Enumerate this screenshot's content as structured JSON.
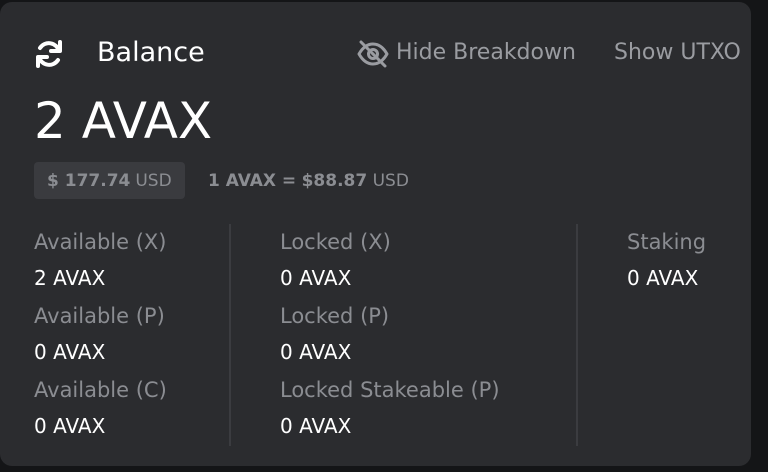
{
  "header": {
    "refresh_icon": "refresh-icon",
    "title": "Balance",
    "hide_icon": "eye-off-icon",
    "hide_breakdown_label": "Hide Breakdown",
    "show_utxo_label": "Show UTXO"
  },
  "balance": {
    "total": "2 AVAX",
    "usd_amount": "$ 177.74",
    "usd_currency": "USD",
    "rate_prefix": "1 AVAX =",
    "rate_value": "$88.87",
    "rate_currency": "USD"
  },
  "breakdown": {
    "available_x": {
      "label": "Available (X)",
      "value": "2 AVAX"
    },
    "available_p": {
      "label": "Available (P)",
      "value": "0 AVAX"
    },
    "available_c": {
      "label": "Available (C)",
      "value": "0 AVAX"
    },
    "locked_x": {
      "label": "Locked (X)",
      "value": "0 AVAX"
    },
    "locked_p": {
      "label": "Locked (P)",
      "value": "0 AVAX"
    },
    "locked_stakeable_p": {
      "label": "Locked Stakeable (P)",
      "value": "0 AVAX"
    },
    "staking": {
      "label": "Staking",
      "value": "0 AVAX"
    }
  },
  "colors": {
    "background": "#141517",
    "card": "#2b2c2f",
    "text_primary": "#ffffff",
    "text_muted": "#8b8d92",
    "pill": "#3a3b3f"
  }
}
